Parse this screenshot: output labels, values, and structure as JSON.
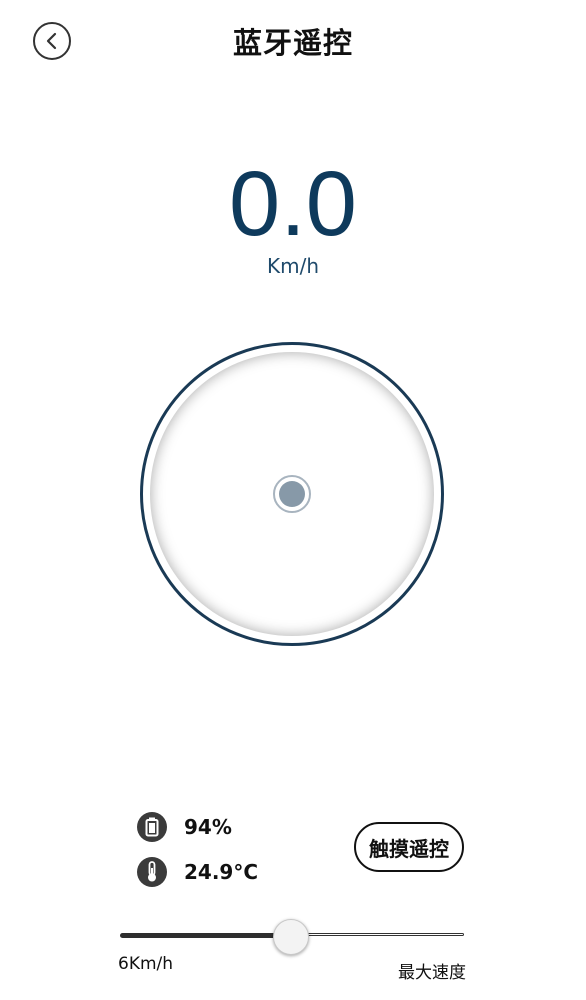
{
  "header": {
    "title": "蓝牙遥控",
    "back_icon": "chevron-left-icon"
  },
  "speed": {
    "value": "0.0",
    "unit": "Km/h"
  },
  "joystick": {
    "knob_x": 0,
    "knob_y": 0
  },
  "stats": {
    "battery": {
      "icon": "battery-icon",
      "value": "94%"
    },
    "temperature": {
      "icon": "thermometer-icon",
      "value": "24.9°C"
    }
  },
  "touch_remote": {
    "label": "触摸遥控"
  },
  "speed_slider": {
    "min_label": "6Km/h",
    "max_label": "最大速度",
    "fill_fraction": 0.5
  },
  "colors": {
    "accent": "#0e3a5c",
    "knob": "#8799a8"
  }
}
